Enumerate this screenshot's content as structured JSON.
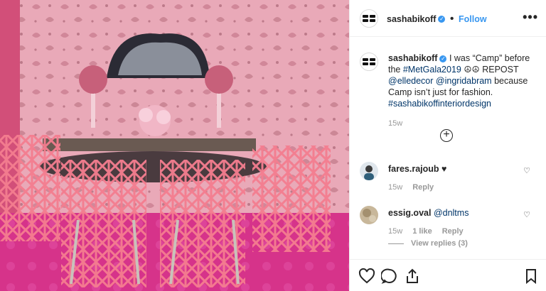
{
  "post": {
    "username": "sashabikoff",
    "follow_label": "Follow",
    "more_label": "•••",
    "caption_prefix": "I was “Camp” before the ",
    "caption_tag1": "#MetGala2019",
    "caption_mid": " ☮☮ REPOST ",
    "caption_tag2": "@elledecor",
    "caption_tag3": "@ingridabram",
    "caption_suffix": " because Camp isn’t just for fashion. ",
    "caption_tag4": "#sashabikoffinteriordesign",
    "time": "15w",
    "add_comment_label": "+"
  },
  "comments": [
    {
      "username": "fares.rajoub",
      "text": "♥",
      "time": "15w",
      "reply_label": "Reply",
      "likes": ""
    },
    {
      "username": "essig.oval",
      "text": "@dnltms",
      "time": "15w",
      "likes": "1 like",
      "reply_label": "Reply",
      "view_replies": "View replies (3)"
    }
  ],
  "colors": {
    "accent": "#3897f0",
    "wallpaper": "#e8a5b6",
    "carpet": "#d8338a"
  },
  "icons": [
    "heart-icon",
    "comment-icon",
    "share-icon",
    "bookmark-icon",
    "verified-icon",
    "plus-circle-icon"
  ]
}
